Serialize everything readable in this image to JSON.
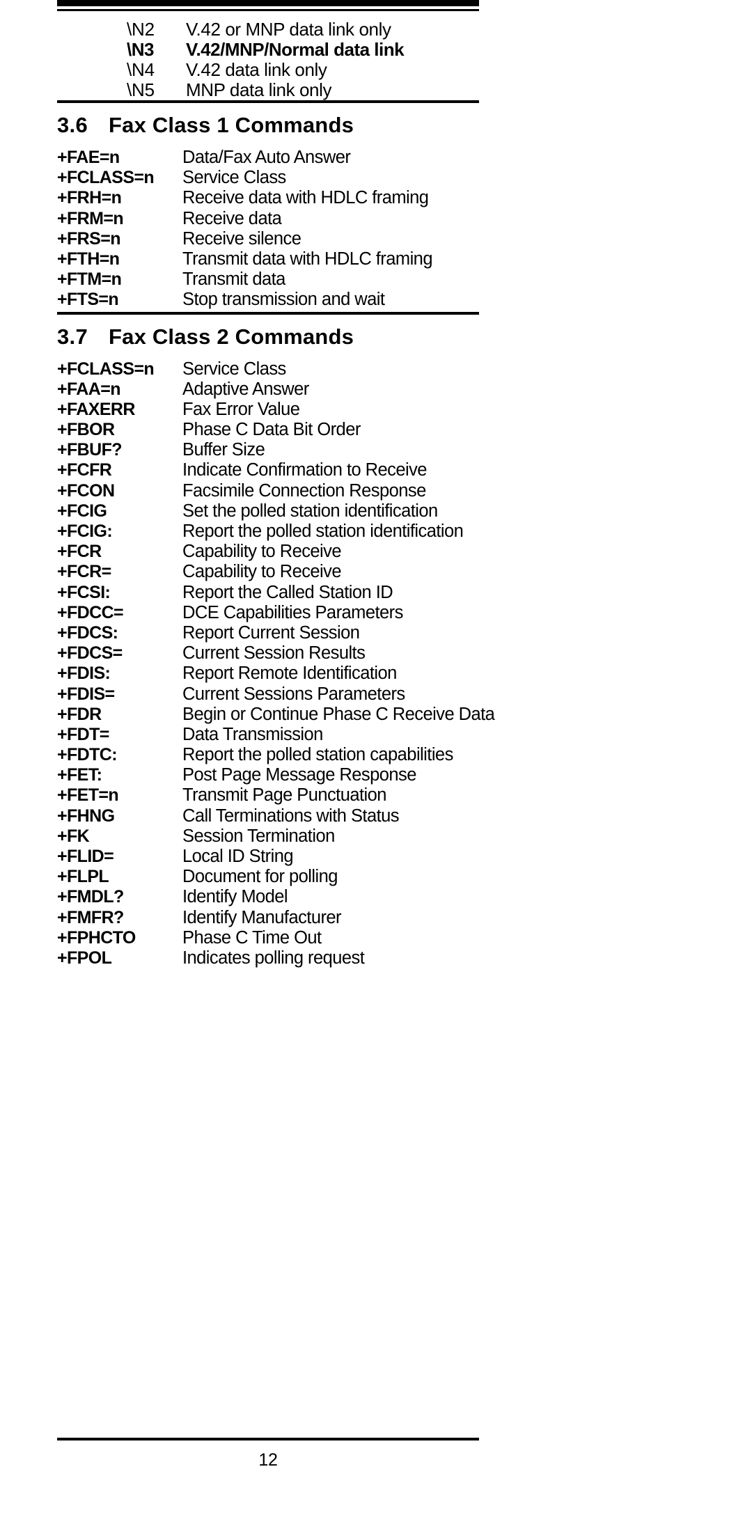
{
  "document": {
    "page_number": "12"
  },
  "continued_options": {
    "rows": [
      {
        "code": "\\N2",
        "desc": "V.42 or MNP data link only",
        "bold": false
      },
      {
        "code": "\\N3",
        "desc": "V.42/MNP/Normal data link",
        "bold": true
      },
      {
        "code": "\\N4",
        "desc": "V.42 data link only",
        "bold": false
      },
      {
        "code": "\\N5",
        "desc": "MNP data link only",
        "bold": false
      }
    ]
  },
  "sections": [
    {
      "number": "3.6",
      "title": "Fax Class 1 Commands",
      "commands": [
        {
          "name": "+FAE=n",
          "desc": "Data/Fax Auto Answer"
        },
        {
          "name": "+FCLASS=n",
          "desc": "Service Class"
        },
        {
          "name": "+FRH=n",
          "desc": "Receive data with HDLC framing"
        },
        {
          "name": "+FRM=n",
          "desc": "Receive data"
        },
        {
          "name": "+FRS=n",
          "desc": "Receive silence"
        },
        {
          "name": "+FTH=n",
          "desc": "Transmit data with HDLC framing"
        },
        {
          "name": "+FTM=n",
          "desc": "Transmit data"
        },
        {
          "name": "+FTS=n",
          "desc": "Stop transmission and wait"
        }
      ]
    },
    {
      "number": "3.7",
      "title": "Fax Class 2 Commands",
      "commands": [
        {
          "name": "+FCLASS=n",
          "desc": "Service Class"
        },
        {
          "name": "+FAA=n",
          "desc": "Adaptive Answer"
        },
        {
          "name": "+FAXERR",
          "desc": "Fax Error Value"
        },
        {
          "name": "+FBOR",
          "desc": "Phase C Data Bit Order"
        },
        {
          "name": "+FBUF?",
          "desc": "Buffer Size"
        },
        {
          "name": "+FCFR",
          "desc": "Indicate Confirmation to Receive"
        },
        {
          "name": "+FCON",
          "desc": "Facsimile Connection Response"
        },
        {
          "name": "+FCIG",
          "desc": "Set the polled station identification"
        },
        {
          "name": "+FCIG:",
          "desc": "Report the polled station identification"
        },
        {
          "name": "+FCR",
          "desc": "Capability to Receive"
        },
        {
          "name": "+FCR=",
          "desc": "Capability to Receive"
        },
        {
          "name": "+FCSI:",
          "desc": "Report the Called Station ID"
        },
        {
          "name": "+FDCC=",
          "desc": "DCE Capabilities Parameters"
        },
        {
          "name": "+FDCS:",
          "desc": "Report Current Session"
        },
        {
          "name": "+FDCS=",
          "desc": "Current Session Results"
        },
        {
          "name": "+FDIS:",
          "desc": "Report Remote Identification"
        },
        {
          "name": "+FDIS=",
          "desc": "Current Sessions Parameters"
        },
        {
          "name": "+FDR",
          "desc": "Begin or Continue Phase C Receive Data"
        },
        {
          "name": "+FDT=",
          "desc": "Data Transmission"
        },
        {
          "name": "+FDTC:",
          "desc": "Report the polled station capabilities"
        },
        {
          "name": "+FET:",
          "desc": "Post Page Message Response"
        },
        {
          "name": "+FET=n",
          "desc": "Transmit Page Punctuation"
        },
        {
          "name": "+FHNG",
          "desc": "Call Terminations with Status"
        },
        {
          "name": "+FK",
          "desc": "Session Termination"
        },
        {
          "name": "+FLID=",
          "desc": "Local ID String"
        },
        {
          "name": "+FLPL",
          "desc": "Document for polling"
        },
        {
          "name": "+FMDL?",
          "desc": "Identify Model"
        },
        {
          "name": "+FMFR?",
          "desc": "Identify Manufacturer"
        },
        {
          "name": "+FPHCTO",
          "desc": "Phase C Time Out"
        },
        {
          "name": "+FPOL",
          "desc": "Indicates polling request"
        }
      ]
    }
  ]
}
